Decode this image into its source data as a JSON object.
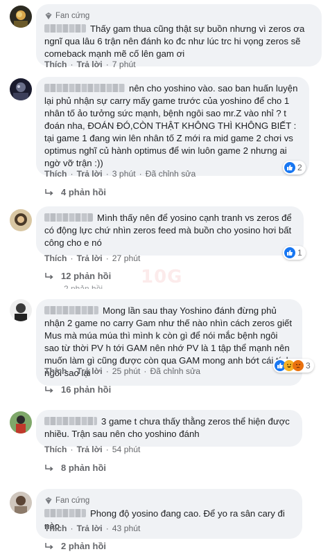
{
  "ui": {
    "like_label": "Thích",
    "reply_label": "Trả lời",
    "edited_label": "Đã chỉnh sửa",
    "fan_badge": "Fan cứng",
    "watermark": "10G"
  },
  "comments": [
    {
      "fan": true,
      "text": "Thấy gam thua cũng thật sự buồn nhưng vì zeros ơa ngnĩ qua lâu 6 trận nên đánh ko đc như lúc trc hi vọng zeros sẽ comeback mạnh mẽ cố lên gam ơi",
      "time": "7 phút",
      "edited": false,
      "reaction": null,
      "replies": null
    },
    {
      "fan": false,
      "text": "nên cho yoshino vào. sao ban huấn luyện lại phủ nhận sự carry mấy game trước của yoshino để cho 1 nhân tố ảo tưởng sức mạnh, bệnh ngôi sao mr.Z vào nhỉ ? t đoán nha, ĐOÁN ĐÓ,CÒN THẬT KHÔNG THÌ KHÔNG BIẾT : tại game 1 đang win lên nhân tố Z mới ra mid game 2 chơi vs optimus nghĩ củ hành optimus để win luôn game 2 nhưng ai ngờ vỡ trận :))",
      "time": "3 phút",
      "edited": true,
      "reaction": {
        "count": "2",
        "types": [
          "like"
        ]
      },
      "replies": "4 phản hồi"
    },
    {
      "fan": false,
      "text": "Mình thấy nên để yosino cạnh tranh vs zeros để có động lực chứ nhìn zeros feed mà buồn cho yosino hơi bất công cho e nó",
      "time": "27 phút",
      "edited": false,
      "reaction": {
        "count": "1",
        "types": [
          "like"
        ]
      },
      "replies": "12 phản hồi",
      "overlap": "2 phản hồi"
    },
    {
      "fan": false,
      "text": "Mong lần sau thay Yoshino đánh đừng phủ nhận 2 game no carry Gam như thế nào nhìn cách zeros giết Mus mà múa múa thì mình k còn gì để nói mắc bệnh ngôi sao từ thời PV h tới GAM nên nhớ PV là 1 tập thể mạnh nên muốn làm gì cũng được còn qua GAM mong anh bớt cái tính ngôi sao lại",
      "time": "25 phút",
      "edited": true,
      "reaction": {
        "count": "3",
        "types": [
          "like",
          "haha",
          "angry"
        ]
      },
      "replies": "16 phản hồi"
    },
    {
      "fan": false,
      "text": "3 game t chưa thấy thằng zeros thể hiện được nhiều. Trận sau nên cho yoshino đánh",
      "time": "54 phút",
      "edited": false,
      "reaction": null,
      "replies": "8 phản hồi"
    },
    {
      "fan": true,
      "text": "Phong độ yosino đang cao. Để yo ra sân cary đi nào",
      "time": "43 phút",
      "edited": false,
      "reaction": null,
      "replies": "2 phản hồi"
    }
  ],
  "colors": {
    "bubble": "#f0f2f5",
    "muted_text": "#65676b",
    "like_blue": "#1877f2"
  }
}
